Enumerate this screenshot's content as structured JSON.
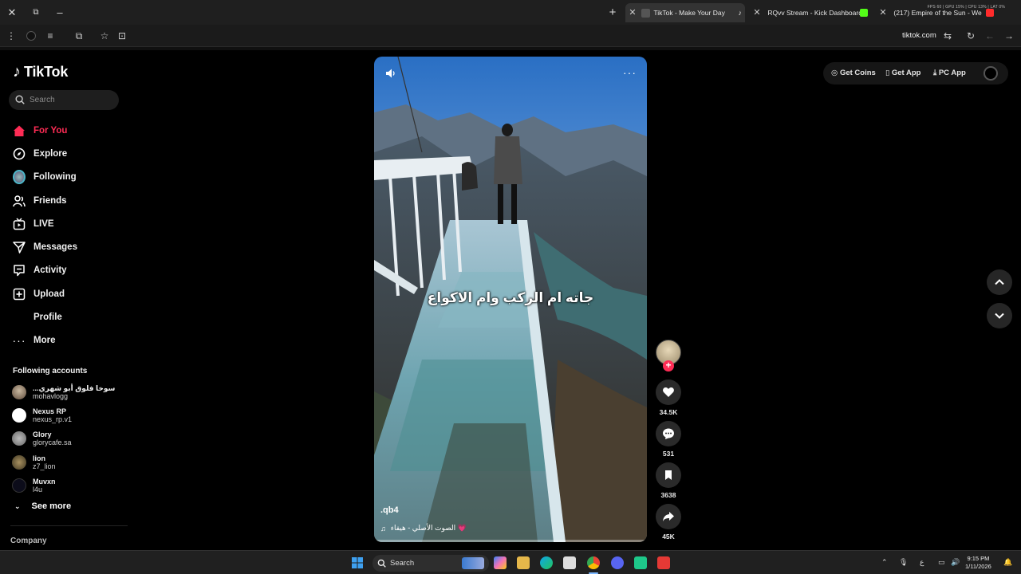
{
  "browser": {
    "tabs": [
      {
        "title": "TikTok - Make Your Day",
        "active": true
      },
      {
        "title": "RQvv Stream - Kick Dashboard",
        "active": false
      },
      {
        "title": "(217) Empire of the Sun - We",
        "active": false
      }
    ],
    "url": "tiktok.com",
    "perf_overlay": "FPS 60 | GPU 15% | CPU 13% | LAT 0%"
  },
  "sidebar": {
    "logo": "TikTok",
    "search_placeholder": "Search",
    "nav": [
      {
        "label": "For You",
        "icon": "home-icon",
        "active": true
      },
      {
        "label": "Explore",
        "icon": "compass-icon"
      },
      {
        "label": "Following",
        "icon": "following-avatar-icon"
      },
      {
        "label": "Friends",
        "icon": "friends-icon"
      },
      {
        "label": "LIVE",
        "icon": "live-tv-icon"
      },
      {
        "label": "Messages",
        "icon": "messages-icon"
      },
      {
        "label": "Activity",
        "icon": "activity-icon"
      },
      {
        "label": "Upload",
        "icon": "upload-icon"
      },
      {
        "label": "Profile",
        "icon": "profile-icon"
      },
      {
        "label": "More",
        "icon": "more-icon"
      }
    ],
    "following_title": "Following accounts",
    "following": [
      {
        "name": "...سوخا فلوق أبو شهري",
        "handle": "mohavlogg"
      },
      {
        "name": "Nexus RP",
        "handle": "nexus_rp.v1"
      },
      {
        "name": "Glory",
        "handle": "glorycafe.sa"
      },
      {
        "name": "lion",
        "handle": "z7_lion"
      },
      {
        "name": "Muvxn",
        "handle": "l4u"
      }
    ],
    "see_more": "See more",
    "company": "Company"
  },
  "video": {
    "caption": "جاته ام الركب وام الاكواع",
    "author": ".qb4",
    "music": "الصوت الأصلي - هيفاء 💗"
  },
  "actions": {
    "likes": "34.5K",
    "comments": "531",
    "saves": "3638",
    "shares": "45K"
  },
  "top_right": {
    "get_coins": "Get Coins",
    "get_app": "Get App",
    "pc_app": "PC App"
  },
  "taskbar": {
    "search": "Search",
    "time": "9:15 PM",
    "date": "1/11/2026",
    "lang": "ع"
  },
  "colors": {
    "accent": "#fe2c55",
    "background": "#000000"
  }
}
